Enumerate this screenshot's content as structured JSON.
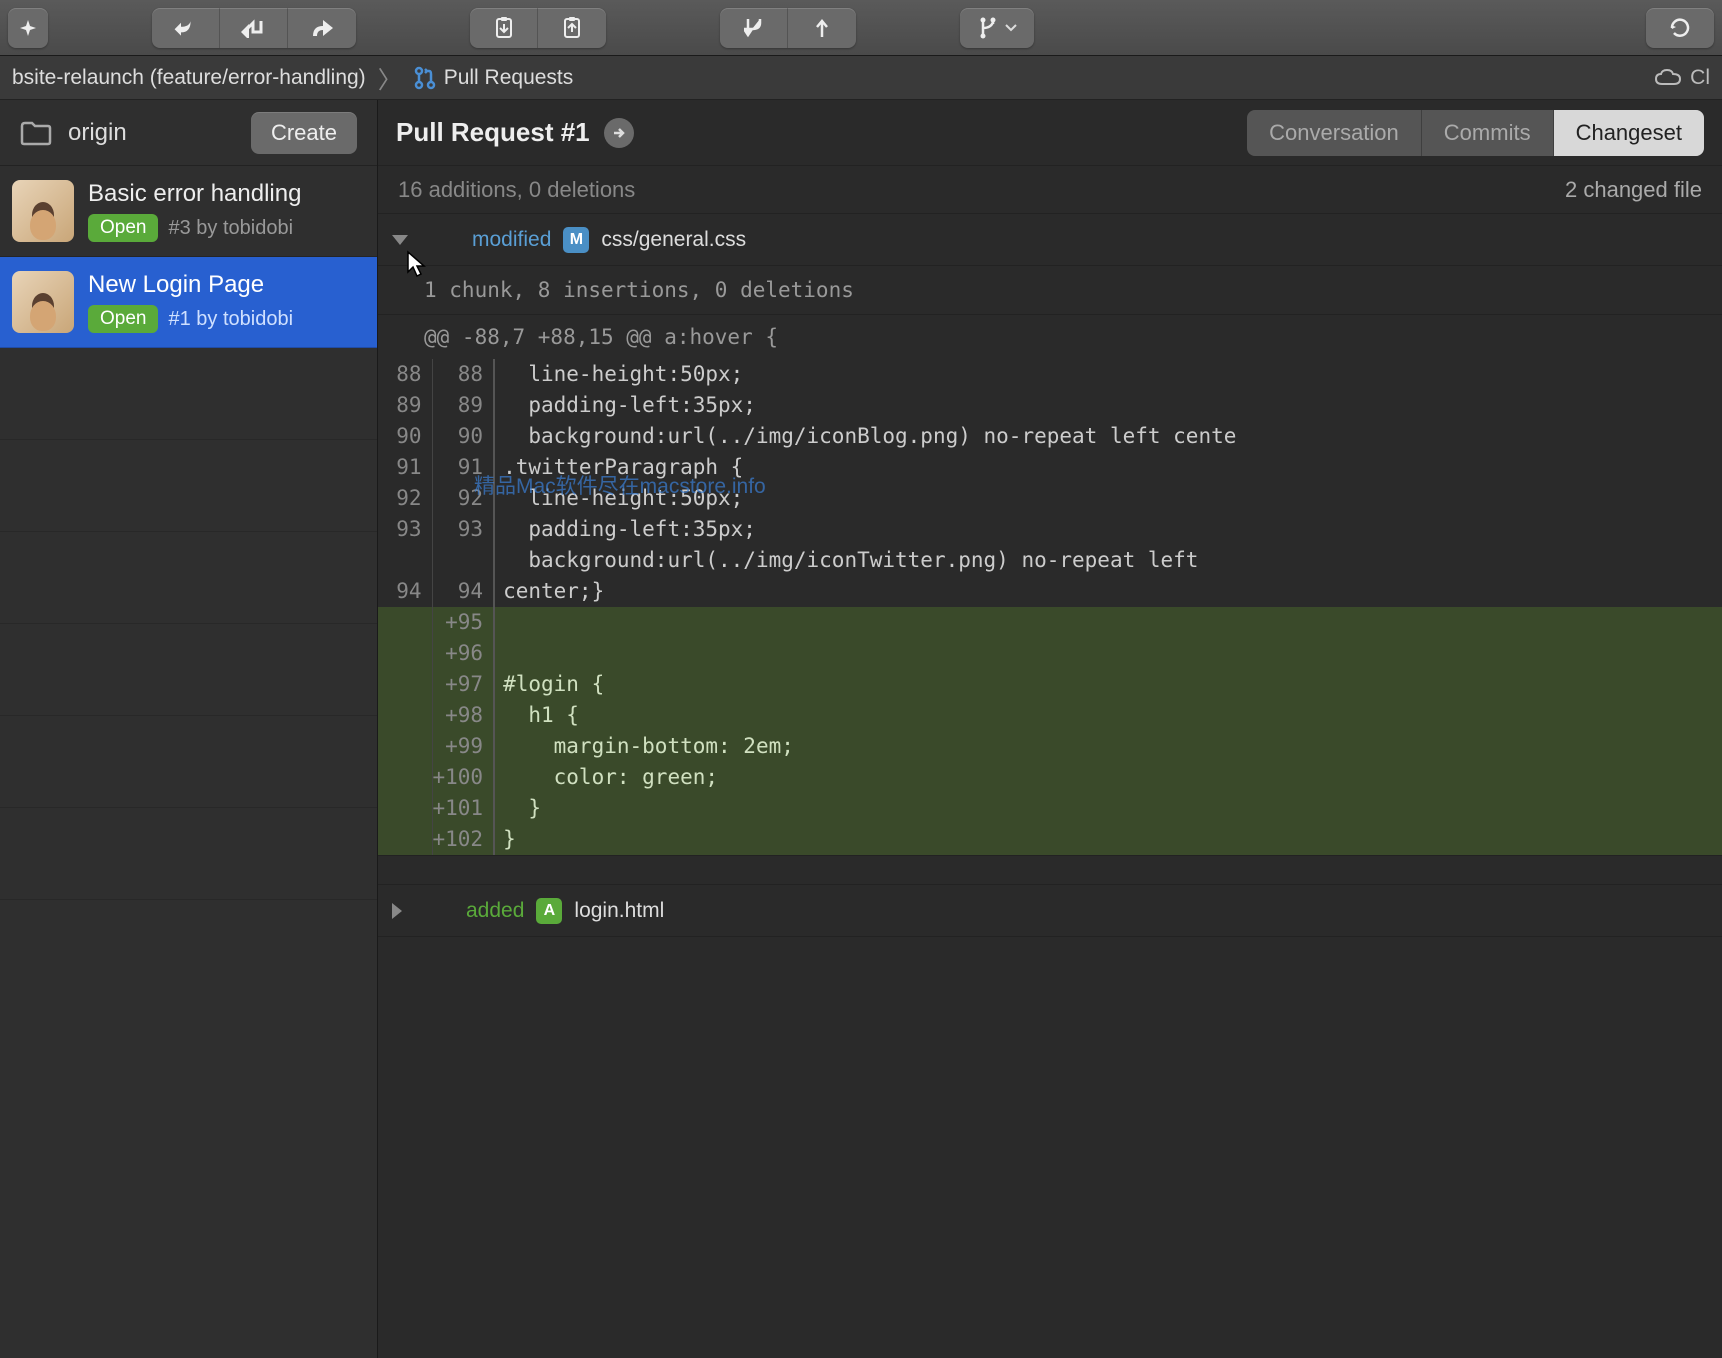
{
  "breadcrumb": {
    "repo": "bsite-relaunch (feature/error-handling)",
    "page": "Pull Requests",
    "cloud": "Cl"
  },
  "sidebar": {
    "origin": "origin",
    "create": "Create",
    "items": [
      {
        "title": "Basic error handling",
        "status": "Open",
        "sub": "#3 by tobidobi"
      },
      {
        "title": "New Login Page",
        "status": "Open",
        "sub": "#1 by tobidobi"
      }
    ]
  },
  "pr": {
    "title": "Pull Request #1",
    "tabs": {
      "conversation": "Conversation",
      "commits": "Commits",
      "changeset": "Changeset"
    },
    "stats_left": "16 additions, 0 deletions",
    "stats_right": "2 changed file"
  },
  "file1": {
    "status": "modified",
    "badge": "M",
    "name": "css/general.css",
    "chunk": "1 chunk, 8 insertions, 0 deletions",
    "hunk": "@@ -88,7 +88,15 @@ a:hover {",
    "lines": [
      {
        "old": "88",
        "new": "88",
        "code": "  line-height:50px;",
        "add": false
      },
      {
        "old": "89",
        "new": "89",
        "code": "  padding-left:35px;",
        "add": false
      },
      {
        "old": "90",
        "new": "90",
        "code": "  background:url(../img/iconBlog.png) no-repeat left cente",
        "add": false
      },
      {
        "old": "91",
        "new": "91",
        "code": ".twitterParagraph {",
        "add": false
      },
      {
        "old": "92",
        "new": "92",
        "code": "  line-height:50px;",
        "add": false
      },
      {
        "old": "93",
        "new": "93",
        "code": "  padding-left:35px;",
        "add": false
      },
      {
        "old": "",
        "new": "",
        "code": "  background:url(../img/iconTwitter.png) no-repeat left",
        "add": false
      },
      {
        "old": "94",
        "new": "94",
        "code": "center;}",
        "add": false
      },
      {
        "old": "",
        "new": "+95",
        "code": "",
        "add": true
      },
      {
        "old": "",
        "new": "+96",
        "code": "",
        "add": true
      },
      {
        "old": "",
        "new": "+97",
        "code": "#login {",
        "add": true
      },
      {
        "old": "",
        "new": "+98",
        "code": "  h1 {",
        "add": true
      },
      {
        "old": "",
        "new": "+99",
        "code": "    margin-bottom: 2em;",
        "add": true
      },
      {
        "old": "",
        "new": "+100",
        "code": "    color: green;",
        "add": true
      },
      {
        "old": "",
        "new": "+101",
        "code": "  }",
        "add": true
      },
      {
        "old": "",
        "new": "+102",
        "code": "}",
        "add": true
      }
    ]
  },
  "file2": {
    "status": "added",
    "badge": "A",
    "name": "login.html"
  },
  "watermark": "精品Mac软件尽在macstore.info"
}
